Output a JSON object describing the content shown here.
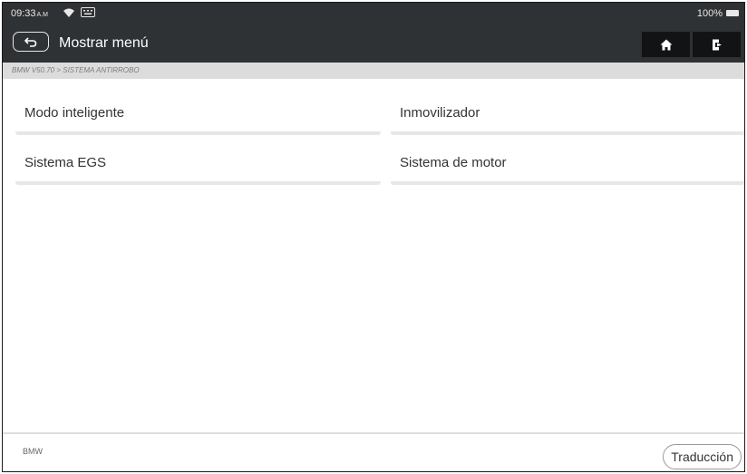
{
  "statusbar": {
    "time": "09:33",
    "ampm": "A.M",
    "battery": "100%"
  },
  "header": {
    "title": "Mostrar menú"
  },
  "breadcrumb": "BMW V50.70 > SISTEMA ANTIRROBO",
  "menu": {
    "items": [
      {
        "label": "Modo inteligente"
      },
      {
        "label": "Inmovilizador"
      },
      {
        "label": "Sistema EGS"
      },
      {
        "label": "Sistema de motor"
      }
    ]
  },
  "footer": {
    "brand": "BMW",
    "translate_label": "Traducción"
  },
  "icons": {
    "back": "back-arrow-icon",
    "home": "home-icon",
    "exit": "exit-icon",
    "wifi": "wifi-icon",
    "keyboard": "keyboard-icon",
    "battery": "battery-icon"
  },
  "colors": {
    "header_bg": "#2f3235",
    "button_dark": "#111314",
    "breadcrumb_bg": "#dcdcdc"
  }
}
